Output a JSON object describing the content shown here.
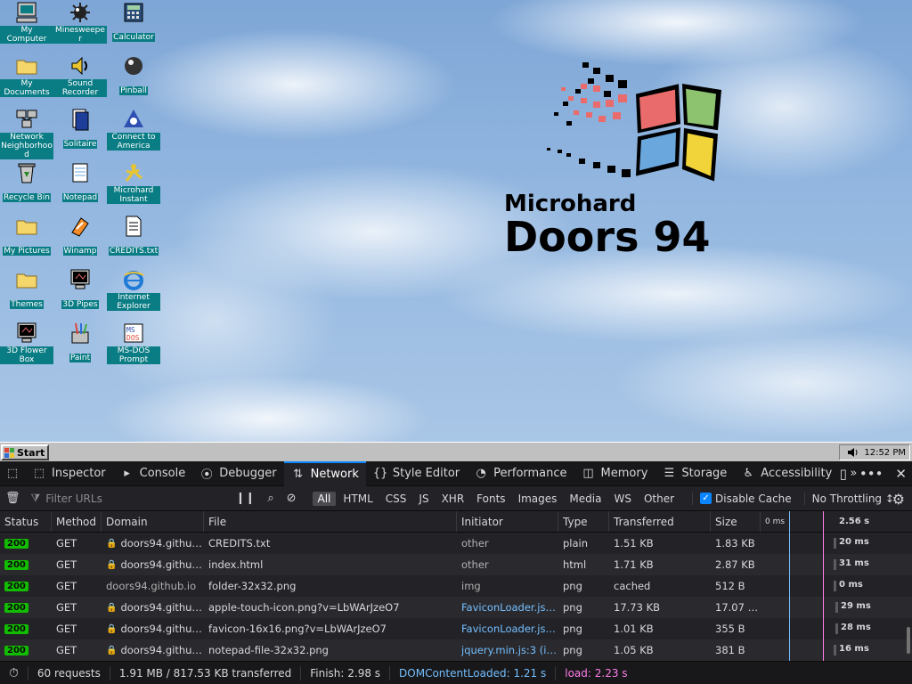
{
  "desktop": {
    "icons": [
      {
        "label": "My Computer",
        "icon": "computer-icon"
      },
      {
        "label": "Minesweeper",
        "icon": "mine-icon"
      },
      {
        "label": "Calculator",
        "icon": "calculator-icon"
      },
      {
        "label": "My Documents",
        "icon": "folder-icon"
      },
      {
        "label": "Sound Recorder",
        "icon": "sound-icon"
      },
      {
        "label": "Pinball",
        "icon": "pinball-icon"
      },
      {
        "label": "Network Neighborhood",
        "icon": "network-icon"
      },
      {
        "label": "Solitaire",
        "icon": "cards-icon"
      },
      {
        "label": "Connect to America",
        "icon": "aol-icon"
      },
      {
        "label": "Recycle Bin",
        "icon": "recycle-icon"
      },
      {
        "label": "Notepad",
        "icon": "notepad-icon"
      },
      {
        "label": "Microhard Instant",
        "icon": "messenger-icon"
      },
      {
        "label": "My Pictures",
        "icon": "folder-icon"
      },
      {
        "label": "Winamp",
        "icon": "winamp-icon"
      },
      {
        "label": "CREDITS.txt",
        "icon": "text-file-icon"
      },
      {
        "label": "Themes",
        "icon": "folder-icon"
      },
      {
        "label": "3D Pipes",
        "icon": "screensaver-icon"
      },
      {
        "label": "Internet Explorer",
        "icon": "ie-icon"
      },
      {
        "label": "3D Flower Box",
        "icon": "screensaver-icon"
      },
      {
        "label": "Paint",
        "icon": "paint-icon"
      },
      {
        "label": "MS-DOS Prompt",
        "icon": "msdos-icon"
      }
    ],
    "logo": {
      "line1": "Microhard",
      "line2": "Doors 94"
    }
  },
  "taskbar": {
    "start_label": "Start",
    "clock": "12:52 PM"
  },
  "devtools": {
    "tabs": [
      {
        "label": "Inspector",
        "icon": "inspector-icon"
      },
      {
        "label": "Console",
        "icon": "console-icon"
      },
      {
        "label": "Debugger",
        "icon": "debugger-icon"
      },
      {
        "label": "Network",
        "icon": "network-arrows-icon"
      },
      {
        "label": "Style Editor",
        "icon": "braces-icon"
      },
      {
        "label": "Performance",
        "icon": "gauge-icon"
      },
      {
        "label": "Memory",
        "icon": "memory-icon"
      },
      {
        "label": "Storage",
        "icon": "storage-icon"
      },
      {
        "label": "Accessibility",
        "icon": "accessibility-icon"
      }
    ],
    "active_tab": "Network",
    "toolbar": {
      "filter_placeholder": "Filter URLs",
      "type_filters": [
        "All",
        "HTML",
        "CSS",
        "JS",
        "XHR",
        "Fonts",
        "Images",
        "Media",
        "WS",
        "Other"
      ],
      "active_filter": "All",
      "disable_cache_label": "Disable Cache",
      "disable_cache_checked": true,
      "throttling": "No Throttling ↕"
    },
    "columns": {
      "status": "Status",
      "method": "Method",
      "domain": "Domain",
      "file": "File",
      "initiator": "Initiator",
      "type": "Type",
      "transferred": "Transferred",
      "size": "Size",
      "wf_start": "0 ms",
      "wf_end": "2.56 s"
    },
    "rows": [
      {
        "status": "200",
        "method": "GET",
        "secure": true,
        "domain": "doors94.githu…",
        "file": "CREDITS.txt",
        "initiator": "other",
        "initiator_link": false,
        "type": "plain",
        "transferred": "1.51 KB",
        "size": "1.83 KB",
        "time": "20 ms",
        "wf_pos": 0.12
      },
      {
        "status": "200",
        "method": "GET",
        "secure": true,
        "domain": "doors94.githu…",
        "file": "index.html",
        "initiator": "other",
        "initiator_link": false,
        "type": "html",
        "transferred": "1.71 KB",
        "size": "2.87 KB",
        "time": "31 ms",
        "wf_pos": 0.12
      },
      {
        "status": "200",
        "method": "GET",
        "secure": false,
        "domain": "doors94.github.io",
        "file": "folder-32x32.png",
        "initiator": "img",
        "initiator_link": false,
        "type": "png",
        "transferred": "cached",
        "size": "512 B",
        "time": "0 ms",
        "wf_pos": 0.12
      },
      {
        "status": "200",
        "method": "GET",
        "secure": true,
        "domain": "doors94.githu…",
        "file": "apple-touch-icon.png?v=LbWArJzeO7",
        "initiator": "FaviconLoader.js…",
        "initiator_link": true,
        "type": "png",
        "transferred": "17.73 KB",
        "size": "17.07 …",
        "time": "29 ms",
        "wf_pos": 0.13
      },
      {
        "status": "200",
        "method": "GET",
        "secure": true,
        "domain": "doors94.githu…",
        "file": "favicon-16x16.png?v=LbWArJzeO7",
        "initiator": "FaviconLoader.js…",
        "initiator_link": true,
        "type": "png",
        "transferred": "1.01 KB",
        "size": "355 B",
        "time": "28 ms",
        "wf_pos": 0.13
      },
      {
        "status": "200",
        "method": "GET",
        "secure": true,
        "domain": "doors94.githu…",
        "file": "notepad-file-32x32.png",
        "initiator": "jquery.min.js:3 (i…",
        "initiator_link": true,
        "type": "png",
        "transferred": "1.05 KB",
        "size": "381 B",
        "time": "16 ms",
        "wf_pos": 0.12
      }
    ],
    "statusbar": {
      "requests": "60 requests",
      "transferred": "1.91 MB / 817.53 KB transferred",
      "finish": "Finish: 2.98 s",
      "dom_loaded": "DOMContentLoaded: 1.21 s",
      "load": "load: 2.23 s"
    },
    "colors": {
      "accent": "#0a84ff",
      "status_ok": "#12bc00",
      "link": "#75bfff",
      "load": "#ff7de9"
    }
  }
}
